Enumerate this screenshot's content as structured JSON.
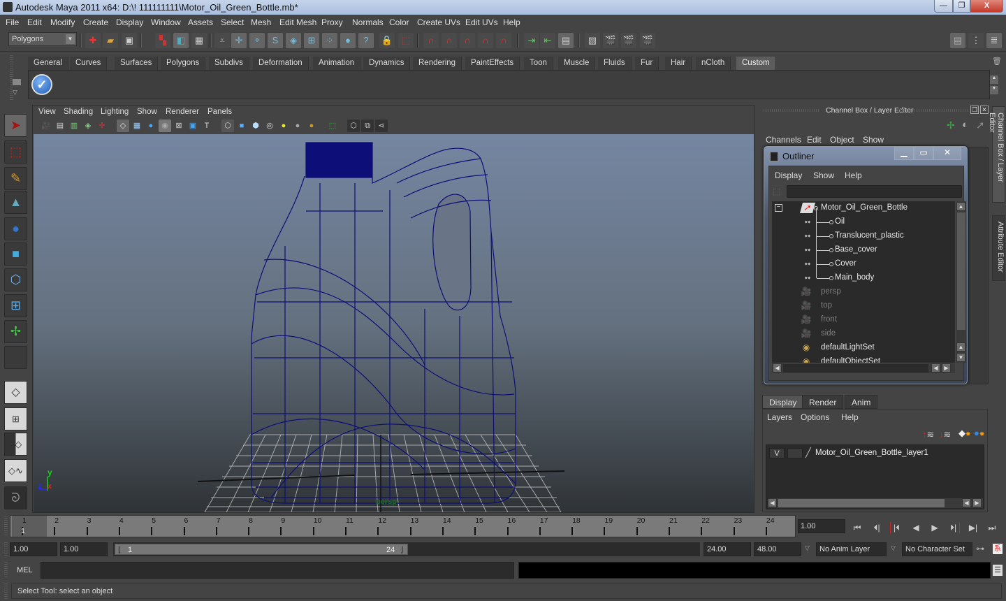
{
  "window": {
    "title": "Autodesk Maya 2011 x64: D:\\! 111111111\\Motor_Oil_Green_Bottle.mb*",
    "minimize": "—",
    "restore": "❐",
    "close": "X"
  },
  "menubar": [
    "File",
    "Edit",
    "Modify",
    "Create",
    "Display",
    "Window",
    "Assets",
    "Select",
    "Mesh",
    "Edit Mesh",
    "Proxy",
    "Normals",
    "Color",
    "Create UVs",
    "Edit UVs",
    "Help"
  ],
  "statusline": {
    "mode": "Polygons",
    "icons": [
      "new-scene-icon",
      "open-scene-icon",
      "save-scene-icon",
      "select-by-hierarchy-icon",
      "select-by-object-icon",
      "select-by-component-icon",
      "lock-selection-icon",
      "snap-grid-icon",
      "snap-curve-icon",
      "snap-point-icon",
      "snap-view-plane-icon",
      "make-live-icon",
      "history-icon",
      "render-icon",
      "ipr-render-icon",
      "render-settings-icon"
    ]
  },
  "shelf": {
    "tabs": [
      "General",
      "Curves",
      "Surfaces",
      "Polygons",
      "Subdivs",
      "Deformation",
      "Animation",
      "Dynamics",
      "Rendering",
      "PaintEffects",
      "Toon",
      "Muscle",
      "Fluids",
      "Fur",
      "Hair",
      "nCloth",
      "Custom"
    ],
    "active_tab": "Custom",
    "items": [
      "checkmark-icon"
    ]
  },
  "toolbox": {
    "tools": [
      "select-tool",
      "lasso-tool",
      "paint-select-tool",
      "move-tool",
      "rotate-tool",
      "scale-tool",
      "universal-manipulator",
      "soft-mod-tool",
      "show-manipulator",
      "last-tool"
    ],
    "layouts": [
      "single-perspective-layout",
      "four-view-layout",
      "outliner-persp-layout",
      "persp-graph-layout",
      "maya-logo"
    ]
  },
  "viewport": {
    "menu": [
      "View",
      "Shading",
      "Lighting",
      "Show",
      "Renderer",
      "Panels"
    ],
    "camera": "persp",
    "axis": {
      "x": "x",
      "y": "y",
      "z": "z"
    },
    "wire_color": "#0d0e78"
  },
  "channel_box": {
    "title": "Channel Box / Layer Editor",
    "menu": [
      "Channels",
      "Edit",
      "Object",
      "Show"
    ]
  },
  "outliner": {
    "title": "Outliner",
    "menu": [
      "Display",
      "Show",
      "Help"
    ],
    "filter": "",
    "items": [
      {
        "label": "Motor_Oil_Green_Bottle",
        "icon": "transform-icon",
        "level": 0,
        "dim": false
      },
      {
        "label": "Oil",
        "icon": "mesh-icon",
        "level": 1,
        "dim": false
      },
      {
        "label": "Translucent_plastic",
        "icon": "mesh-icon",
        "level": 1,
        "dim": false
      },
      {
        "label": "Base_cover",
        "icon": "mesh-icon",
        "level": 1,
        "dim": false
      },
      {
        "label": "Cover",
        "icon": "mesh-icon",
        "level": 1,
        "dim": false
      },
      {
        "label": "Main_body",
        "icon": "mesh-icon",
        "level": 1,
        "dim": false
      },
      {
        "label": "persp",
        "icon": "camera-icon",
        "level": 0,
        "dim": true
      },
      {
        "label": "top",
        "icon": "camera-icon",
        "level": 0,
        "dim": true
      },
      {
        "label": "front",
        "icon": "camera-icon",
        "level": 0,
        "dim": true
      },
      {
        "label": "side",
        "icon": "camera-icon",
        "level": 0,
        "dim": true
      },
      {
        "label": "defaultLightSet",
        "icon": "set-icon",
        "level": 0,
        "dim": false
      },
      {
        "label": "defaultObjectSet",
        "icon": "set-icon",
        "level": 0,
        "dim": false
      }
    ]
  },
  "layer_editor": {
    "tabs": [
      "Display",
      "Render",
      "Anim"
    ],
    "active_tab": "Display",
    "menu": [
      "Layers",
      "Options",
      "Help"
    ],
    "layers": [
      {
        "visible": "V",
        "name": "Motor_Oil_Green_Bottle_layer1"
      }
    ]
  },
  "side_tabs": [
    "Channel Box / Layer Editor",
    "Attribute Editor"
  ],
  "time_slider": {
    "ticks": [
      "1",
      "2",
      "3",
      "4",
      "5",
      "6",
      "7",
      "8",
      "9",
      "10",
      "11",
      "12",
      "13",
      "14",
      "15",
      "16",
      "17",
      "18",
      "19",
      "20",
      "21",
      "22",
      "23",
      "24"
    ],
    "current_frame_marker": "1",
    "current_time": "1.00"
  },
  "playback": {
    "buttons": [
      "go-to-start",
      "step-back-frame",
      "step-back-key",
      "play-backwards",
      "play-forwards",
      "step-forward-key",
      "step-forward-frame",
      "go-to-end"
    ],
    "glyphs": [
      "⏮",
      "⏴|",
      "|⏴",
      "◀",
      "▶",
      "⏵|",
      "▶|",
      "⏭"
    ]
  },
  "range_slider": {
    "start_time": "1.00",
    "playback_start": "1.00",
    "range_start_label": "1",
    "range_end_label": "24",
    "playback_end": "24.00",
    "end_time": "48.00",
    "anim_layer": "No Anim Layer",
    "character_set": "No Character Set"
  },
  "command_line": {
    "label": "MEL",
    "value": "",
    "output": ""
  },
  "help_line": "Select Tool: select an object"
}
